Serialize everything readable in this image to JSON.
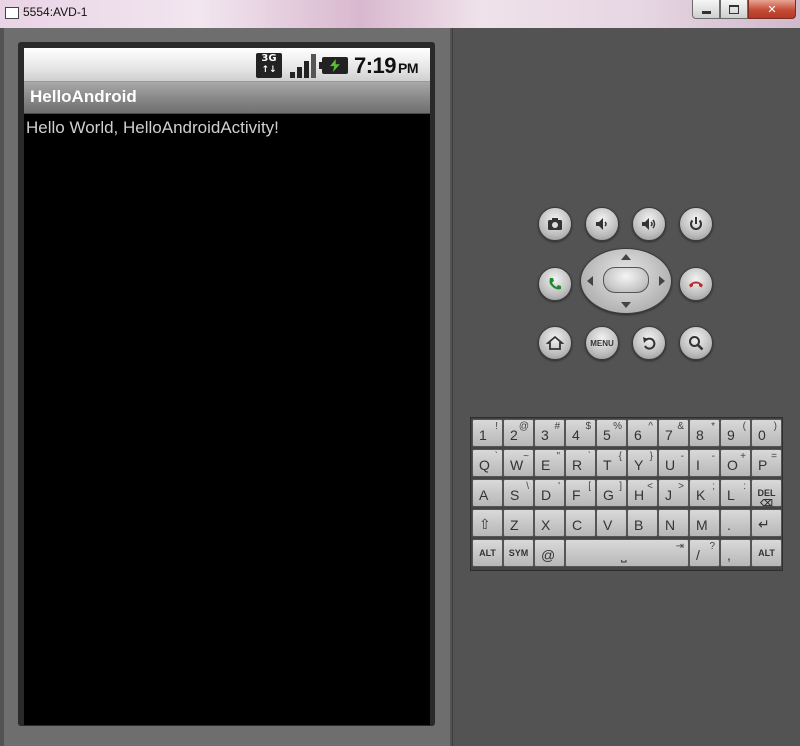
{
  "window": {
    "title": "5554:AVD-1",
    "controls": {
      "minimize": "minimize",
      "maximize": "maximize",
      "close": "close"
    }
  },
  "statusbar": {
    "network": "3G",
    "network_arrows": "↑↓",
    "time": "7:19",
    "ampm": "PM"
  },
  "app": {
    "title": "HelloAndroid",
    "content": "Hello World, HelloAndroidActivity!"
  },
  "controls": {
    "menu_label": "MENU",
    "icons": [
      "camera-icon",
      "volume-down-icon",
      "volume-up-icon",
      "power-icon",
      "call-icon",
      "end-call-icon",
      "home-icon",
      "menu-icon",
      "back-icon",
      "search-icon"
    ]
  },
  "keyboard": {
    "rows": [
      [
        [
          "1",
          "!"
        ],
        [
          "2",
          "@"
        ],
        [
          "3",
          "#"
        ],
        [
          "4",
          "$"
        ],
        [
          "5",
          "%"
        ],
        [
          "6",
          "^"
        ],
        [
          "7",
          "&"
        ],
        [
          "8",
          "*"
        ],
        [
          "9",
          "("
        ],
        [
          "0",
          ")"
        ]
      ],
      [
        [
          "Q",
          "`"
        ],
        [
          "W",
          "~"
        ],
        [
          "E",
          "\""
        ],
        [
          "R",
          "`"
        ],
        [
          "T",
          "{"
        ],
        [
          "Y",
          "}"
        ],
        [
          "U",
          "-"
        ],
        [
          "I",
          "-"
        ],
        [
          "O",
          "+"
        ],
        [
          "P",
          "="
        ]
      ],
      [
        [
          "A",
          ""
        ],
        [
          "S",
          "\\"
        ],
        [
          "D",
          "'"
        ],
        [
          "F",
          "["
        ],
        [
          "G",
          "]"
        ],
        [
          "H",
          "<"
        ],
        [
          "J",
          ">"
        ],
        [
          "K",
          ";"
        ],
        [
          "L",
          ":"
        ],
        [
          "DEL",
          "⌫"
        ]
      ],
      [
        [
          "⇧",
          ""
        ],
        [
          "Z",
          ""
        ],
        [
          "X",
          ""
        ],
        [
          "C",
          ""
        ],
        [
          "V",
          ""
        ],
        [
          "B",
          ""
        ],
        [
          "N",
          ""
        ],
        [
          "M",
          ""
        ],
        [
          ".",
          ""
        ],
        [
          "↵",
          ""
        ]
      ]
    ],
    "bottom_row": {
      "alt_left": "ALT",
      "sym": "SYM",
      "at": "@",
      "space_symbol": "⎵",
      "tab_symbol": "⇥",
      "slash": "/",
      "question": "?",
      "comma": ",",
      "alt_right": "ALT"
    }
  }
}
